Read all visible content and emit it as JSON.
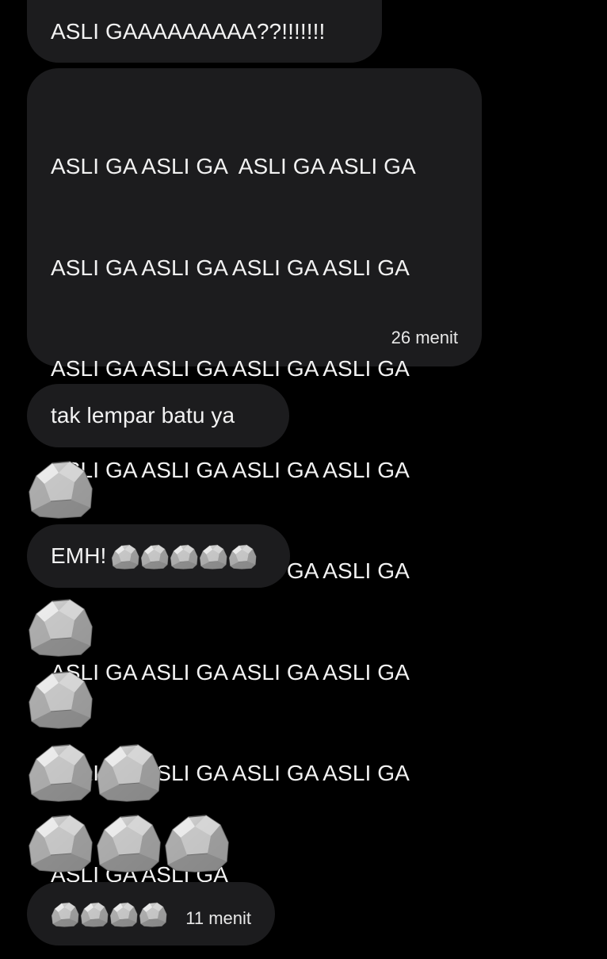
{
  "messages": [
    {
      "text": "ASLI GAAAAAAAAA??!!!!!!!"
    },
    {
      "lines": [
        "ASLI GA ASLI GA  ASLI GA ASLI GA",
        "ASLI GA ASLI GA ASLI GA ASLI GA",
        "ASLI GA ASLI GA ASLI GA ASLI GA",
        "ASLI GA ASLI GA ASLI GA ASLI GA",
        "ASLI GA ASLI GA ASLI GA ASLI GA",
        "ASLI GA ASLI GA ASLI GA ASLI GA",
        "ASLI GA ASLI GA ASLI GA ASLI GA",
        "ASLI GA ASLI GA"
      ],
      "time": "26 menit"
    },
    {
      "text": "tak lempar batu ya"
    },
    {
      "emoji": "rock",
      "count": 1
    },
    {
      "text": "EMH!",
      "emoji": "rock",
      "count": 5
    },
    {
      "emoji": "rock",
      "count": 1
    },
    {
      "emoji": "rock",
      "count": 1
    },
    {
      "emoji": "rock",
      "count": 2
    },
    {
      "emoji": "rock",
      "count": 3
    },
    {
      "emoji": "rock",
      "count": 4,
      "time": "11 menit"
    }
  ],
  "colors": {
    "background": "#000000",
    "bubble": "#1c1c1e",
    "text": "#f2f2f2"
  }
}
